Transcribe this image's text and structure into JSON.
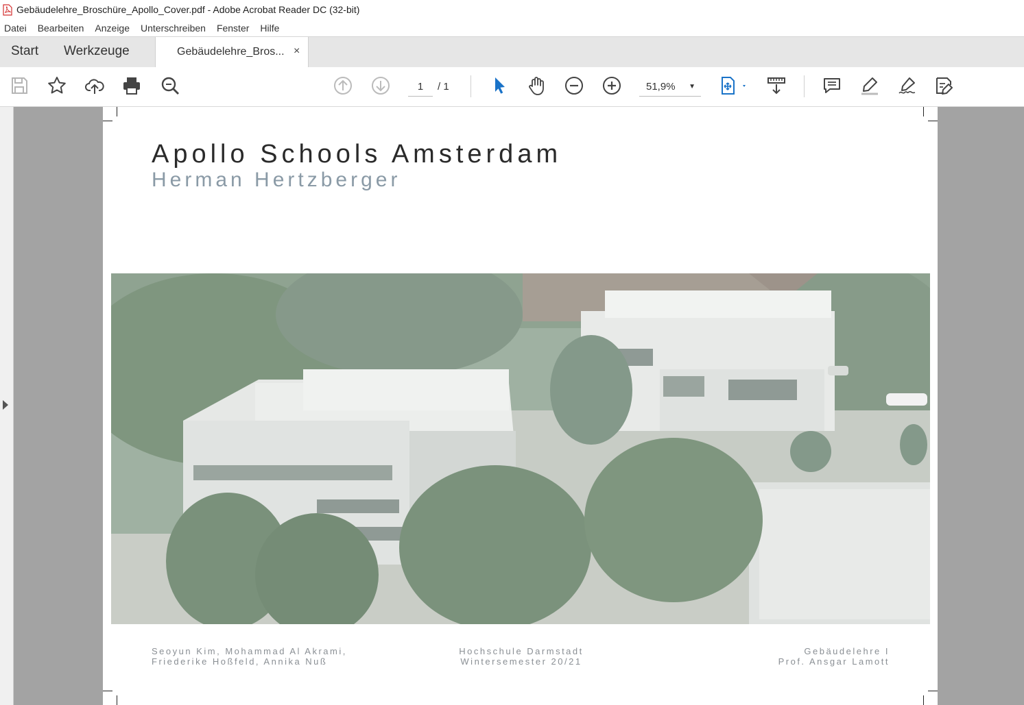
{
  "window": {
    "title": "Gebäudelehre_Broschüre_Apollo_Cover.pdf - Adobe Acrobat Reader DC (32-bit)"
  },
  "menu": [
    "Datei",
    "Bearbeiten",
    "Anzeige",
    "Unterschreiben",
    "Fenster",
    "Hilfe"
  ],
  "tabs": {
    "home": "Start",
    "tools": "Werkzeuge",
    "document": "Gebäudelehre_Bros...",
    "close": "×"
  },
  "toolbar": {
    "page_current": "1",
    "page_total": "/ 1",
    "zoom": "51,9%"
  },
  "document": {
    "title": "Apollo Schools Amsterdam",
    "subtitle": "Herman Hertzberger",
    "footer_left": [
      "Seoyun Kim, Mohammad Al Akrami,",
      "Friederike Hoßfeld, Annika Nuß"
    ],
    "footer_center": [
      "Hochschule Darmstadt",
      "Wintersemester 20/21"
    ],
    "footer_right": [
      "Gebäudelehre I",
      "Prof. Ansgar Lamott"
    ]
  },
  "colors": {
    "accent_blue": "#1a73c8",
    "subtitle_gray": "#8a9aa6",
    "pdf_red": "#d32f2f"
  }
}
